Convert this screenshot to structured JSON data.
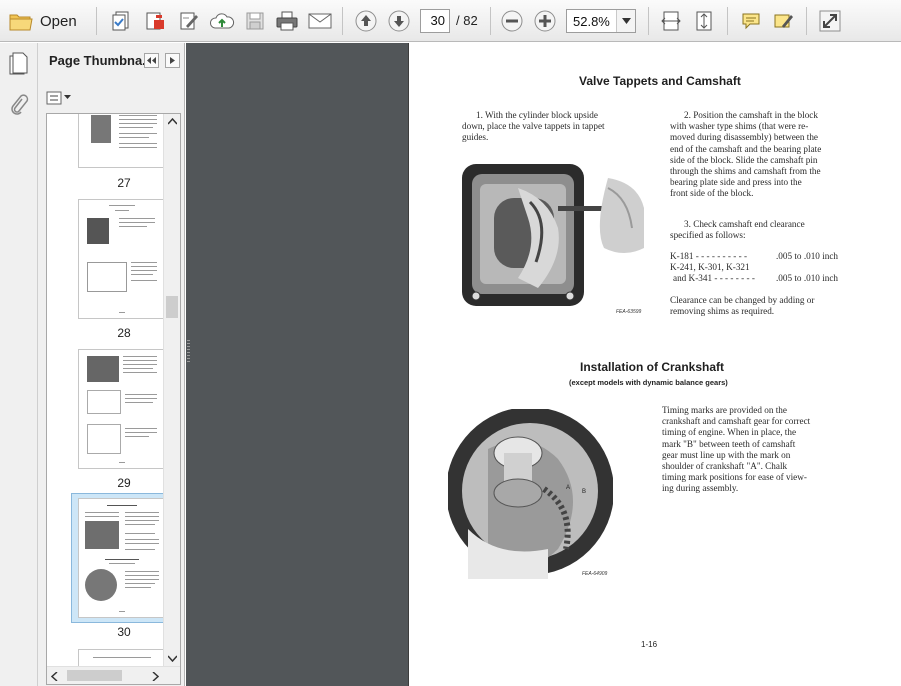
{
  "toolbar": {
    "open_label": "Open",
    "current_page": "30",
    "page_total": "/ 82",
    "zoom": "52.8%",
    "icons": [
      "folder-icon",
      "create-pdf-icon",
      "convert-icon",
      "sign-icon",
      "cloud-upload-icon",
      "save-icon",
      "print-icon",
      "email-icon",
      "page-up-icon",
      "page-down-icon",
      "zoom-out-icon",
      "zoom-in-icon",
      "fit-width-icon",
      "fit-page-icon",
      "comment-icon",
      "highlight-icon",
      "fullscreen-icon"
    ]
  },
  "panel": {
    "title": "Page Thumbna...",
    "thumbnails": [
      {
        "label": "27"
      },
      {
        "label": "28"
      },
      {
        "label": "29"
      },
      {
        "label": "30"
      }
    ]
  },
  "document": {
    "heading1": "Valve Tappets and Camshaft",
    "step1": [
      "1.  With the cylinder block upside",
      "down, place the valve tappets in tappet",
      "guides."
    ],
    "step2": [
      "2.  Position the camshaft in the block",
      "with washer type shims (that were re-",
      "moved during disassembly) between the",
      "end of the camshaft and the bearing plate",
      "side of the block.  Slide the camshaft pin",
      "through the shims and camshaft from the",
      "bearing plate side and press into the",
      "front side of the block."
    ],
    "step3": [
      "3.  Check camshaft end clearance",
      "specified as follows:"
    ],
    "spec1_model": "K-181  - - - - - - - - - -",
    "spec1_value": ".005 to .010 inch",
    "spec2_line1": "K-241, K-301, K-321",
    "spec2_line2": "and K-341 - - - - - - - -",
    "spec2_value": ".005 to .010 inch",
    "clearance_note": [
      "Clearance can be changed by adding or",
      "removing shims as required."
    ],
    "fig1_caption": "FEA-63599",
    "heading2": "Installation of Crankshaft",
    "subheading2": "(except models with dynamic balance gears)",
    "timing_text": [
      "Timing marks are provided on the",
      "crankshaft and camshaft gear for correct",
      "timing of engine.  When in place, the",
      "mark \"B\" between teeth of camshaft",
      "gear must line up with the mark on",
      "shoulder of crankshaft \"A\".  Chalk",
      "timing mark positions for ease of view-",
      "ing during assembly."
    ],
    "fig2_caption": "FEA-64909",
    "fig2_label_a": "A",
    "fig2_label_b": "B",
    "page_number": "1-16"
  }
}
